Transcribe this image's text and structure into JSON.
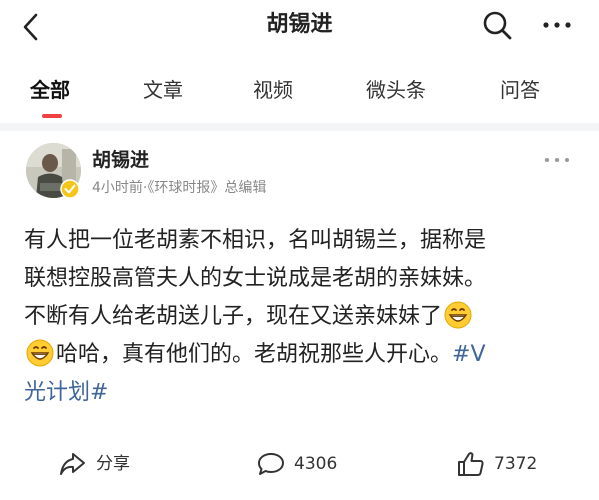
{
  "header": {
    "title": "胡锡进",
    "back_icon": "chevron-left-icon",
    "search_icon": "search-icon",
    "more_icon": "more-horizontal-icon"
  },
  "tabs": [
    {
      "label": "全部",
      "active": true
    },
    {
      "label": "文章",
      "active": false
    },
    {
      "label": "视频",
      "active": false
    },
    {
      "label": "微头条",
      "active": false
    },
    {
      "label": "问答",
      "active": false
    }
  ],
  "post": {
    "author": "胡锡进",
    "time": "4小时前",
    "separator": "·",
    "source": "《环球时报》总编辑",
    "text_lines": [
      "有人把一位老胡素不相识，名叫胡锡兰，据称是",
      "联想控股高管夫人的女士说成是老胡的亲妹妹。",
      "不断有人给老胡送儿子，现在又送亲妹妹了",
      "哈哈，真有他们的。老胡祝那些人开心。",
      "#V",
      "光计划#"
    ],
    "emoji": "grinning-face-icon"
  },
  "actions": {
    "share_label": "分享",
    "comment_count": "4306",
    "like_count": "7372"
  },
  "colors": {
    "accent": "#f04142",
    "hashtag": "#406599",
    "divider": "#f4f5f6",
    "meta_text": "#888888"
  }
}
